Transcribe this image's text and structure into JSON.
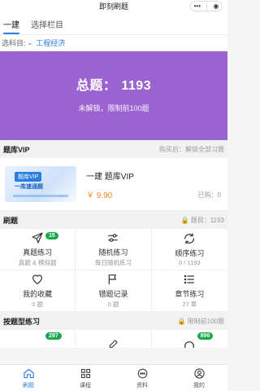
{
  "status_bar": {
    "title": "即刻刷题",
    "menu_icon": "dots-icon",
    "close_icon": "circle-target-icon"
  },
  "tabs": [
    {
      "label": "一建",
      "active": true
    },
    {
      "label": "选择栏目",
      "active": false
    }
  ],
  "subject": {
    "label": "选科目:",
    "value": "工程经济"
  },
  "banner": {
    "total_label": "总题：",
    "total_value": "1193",
    "subtitle": "未解锁，限制前100题",
    "background": "#9b63cf"
  },
  "vip_section": {
    "title": "题库VIP",
    "note": "购买后：解锁全部习题",
    "thumb_tag": "题库VIP",
    "thumb_text": "一库速通题",
    "product_name": "一建 题库VIP",
    "price": "￥ 9.90",
    "bought": "已购：0"
  },
  "practice_section": {
    "title": "刷题",
    "note": "题目：1193",
    "items": [
      {
        "label": "真题练习",
        "desc": "真题 & 模拟题",
        "icon": "send-icon",
        "badge": "15"
      },
      {
        "label": "随机练习",
        "desc": "每日随机练习",
        "icon": "sliders-icon",
        "badge": ""
      },
      {
        "label": "顺序练习",
        "desc": "0 / 1193",
        "icon": "refresh-icon",
        "badge": ""
      },
      {
        "label": "我的收藏",
        "desc": "0 题",
        "icon": "heart-icon",
        "badge": ""
      },
      {
        "label": "错题记录",
        "desc": "0 题",
        "icon": "flag-icon",
        "badge": ""
      },
      {
        "label": "章节练习",
        "desc": "27 章",
        "icon": "list-icon",
        "badge": ""
      }
    ]
  },
  "type_section": {
    "title": "按题型练习",
    "note": "限制前100题",
    "badges": [
      "297",
      "",
      "896"
    ]
  },
  "tabbar": [
    {
      "label": "刷题",
      "icon": "home-icon",
      "active": true
    },
    {
      "label": "课程",
      "icon": "grid-icon",
      "active": false
    },
    {
      "label": "资料",
      "icon": "chat-icon",
      "active": false
    },
    {
      "label": "我的",
      "icon": "user-icon",
      "active": false
    }
  ],
  "colors": {
    "accent": "#2a7de1",
    "price": "#f08a24",
    "badge": "#18a84b"
  }
}
